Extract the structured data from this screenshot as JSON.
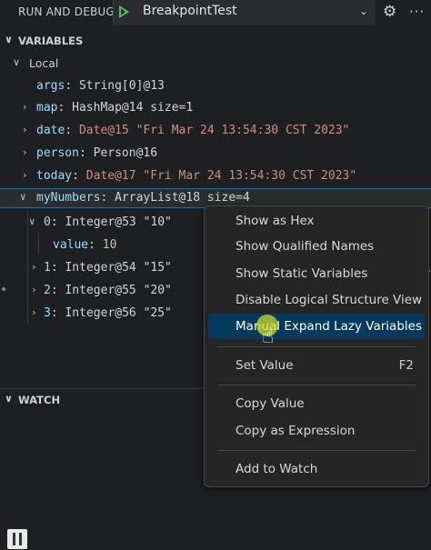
{
  "topbar": {
    "title": "RUN AND DEBUG",
    "config_name": "BreakpointTest",
    "chevron": "⌄",
    "gear_icon": "gear-icon",
    "more": "···"
  },
  "variables": {
    "header": "VARIABLES",
    "scope": "Local",
    "items": [
      {
        "name": "args",
        "value": "String[0]@13"
      },
      {
        "name": "map",
        "value": "HashMap@14 size=1"
      },
      {
        "name": "date",
        "value": "Date@15 \"Fri Mar 24 13:54:30 CST 2023\""
      },
      {
        "name": "person",
        "value": "Person@16"
      },
      {
        "name": "today",
        "value": "Date@17 \"Fri Mar 24 13:54:30 CST 2023\""
      },
      {
        "name": "myNumbers",
        "value": "ArrayList@18 size=4"
      }
    ],
    "children": [
      {
        "name": "0",
        "value": "Integer@53 \"10\""
      },
      {
        "name": "value",
        "value": "10"
      },
      {
        "name": "1",
        "value": "Integer@54 \"15\""
      },
      {
        "name": "2",
        "value": "Integer@55 \"20\""
      },
      {
        "name": "3",
        "value": "Integer@56 \"25\""
      }
    ]
  },
  "watch": {
    "header": "WATCH"
  },
  "context_menu": {
    "items": [
      {
        "label": "Show as Hex"
      },
      {
        "label": "Show Qualified Names"
      },
      {
        "label": "Show Static Variables"
      },
      {
        "label": "Disable Logical Structure View"
      },
      {
        "label": "Manual Expand Lazy Variables"
      },
      {
        "label": "Set Value",
        "shortcut": "F2"
      },
      {
        "label": "Copy Value"
      },
      {
        "label": "Copy as Expression"
      },
      {
        "label": "Add to Watch"
      }
    ]
  },
  "colors": {
    "background": "#1e1f22",
    "menu_background": "#252526",
    "menu_highlight": "#04395e",
    "variable_name": "#9cdcfe",
    "string_value": "#ce9178",
    "play_green": "#4fc36b"
  }
}
